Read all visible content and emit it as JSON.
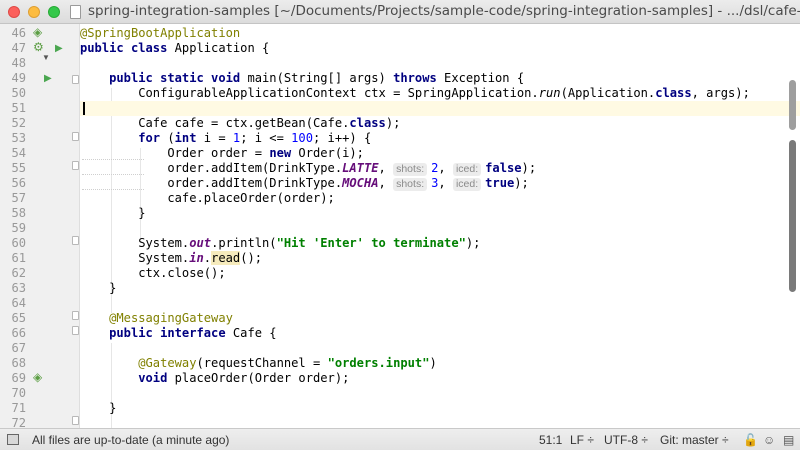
{
  "window": {
    "title": "spring-integration-samples [~/Documents/Projects/sample-code/spring-integration-samples] - .../dsl/cafe-dsl/src/main/java/org/springframework/integration/samples/dsl/cafe/lambda/Application.java"
  },
  "line_numbers": [
    "46",
    "47",
    "48",
    "49",
    "50",
    "51",
    "52",
    "53",
    "54",
    "55",
    "56",
    "57",
    "58",
    "59",
    "60",
    "61",
    "62",
    "63",
    "64",
    "65",
    "66",
    "67",
    "68",
    "69",
    "70",
    "71",
    "72"
  ],
  "code": {
    "l46": {
      "annotation": "@SpringBootApplication"
    },
    "l47": {
      "kw": "public class",
      "text": " Application {"
    },
    "l49": {
      "indent": "    ",
      "kw": "public static void",
      "text1": " main(String[] args) ",
      "kw2": "throws",
      "text2": " Exception {"
    },
    "l50": {
      "indent": "        ",
      "text1": "ConfigurableApplicationContext ctx = SpringApplication.",
      "method": "run",
      "text2": "(Application.",
      "kw": "class",
      "text3": ", args);"
    },
    "l52": {
      "indent": "        ",
      "text1": "Cafe cafe = ctx.getBean(Cafe.",
      "kw": "class",
      "text2": ");"
    },
    "l53": {
      "indent": "        ",
      "kw": "for",
      "text1": " (",
      "kw2": "int",
      "text2": " i = ",
      "num1": "1",
      "text3": "; i <= ",
      "num2": "100",
      "text4": "; i++) {"
    },
    "l54": {
      "indent": "            ",
      "text1": "Order order = ",
      "kw": "new",
      "text2": " Order(i);"
    },
    "l55": {
      "indent": "            ",
      "text1": "order.addItem(DrinkType.",
      "field": "LATTE",
      "text2": ", ",
      "hint1": "shots:",
      "num": "2",
      "text3": ", ",
      "hint2": "iced:",
      "kw": "false",
      "text4": ");"
    },
    "l56": {
      "indent": "            ",
      "text1": "order.addItem(DrinkType.",
      "field": "MOCHA",
      "text2": ", ",
      "hint1": "shots:",
      "num": "3",
      "text3": ", ",
      "hint2": "iced:",
      "kw": "true",
      "text4": ");"
    },
    "l57": {
      "indent": "            ",
      "text": "cafe.placeOrder(order);"
    },
    "l58": {
      "indent": "        ",
      "text": "}"
    },
    "l60": {
      "indent": "        ",
      "text1": "System.",
      "field": "out",
      "text2": ".println(",
      "str": "\"Hit 'Enter' to terminate\"",
      "text3": ");"
    },
    "l61": {
      "indent": "        ",
      "text1": "System.",
      "field": "in",
      "text2": ".",
      "hl": "read",
      "text3": "();"
    },
    "l62": {
      "indent": "        ",
      "text": "ctx.close();"
    },
    "l63": {
      "indent": "    ",
      "text": "}"
    },
    "l65": {
      "indent": "    ",
      "annotation": "@MessagingGateway"
    },
    "l66": {
      "indent": "    ",
      "kw": "public interface",
      "text": " Cafe {"
    },
    "l68": {
      "indent": "        ",
      "annotation": "@Gateway",
      "text1": "(requestChannel = ",
      "str": "\"orders.input\"",
      "text2": ")"
    },
    "l69": {
      "indent": "        ",
      "kw": "void",
      "text": " placeOrder(Order order);"
    },
    "l71": {
      "indent": "    ",
      "text": "}"
    }
  },
  "status_bar": {
    "message": "All files are up-to-date (a minute ago)",
    "position": "51:1",
    "line_separator": "LF ÷",
    "encoding": "UTF-8 ÷",
    "vcs": "Git: master ÷"
  },
  "icons": {
    "run": "run-gutter-icon",
    "bean": "spring-bean-icon",
    "fold": "fold-marker-icon",
    "lock": "lock-icon",
    "inspector": "hector-icon",
    "event_log": "event-log-icon"
  },
  "colors": {
    "keyword": "#000080",
    "annotation": "#808000",
    "string": "#008000",
    "number": "#0000ff",
    "field": "#660e7a",
    "caret_line": "#fffae3"
  }
}
